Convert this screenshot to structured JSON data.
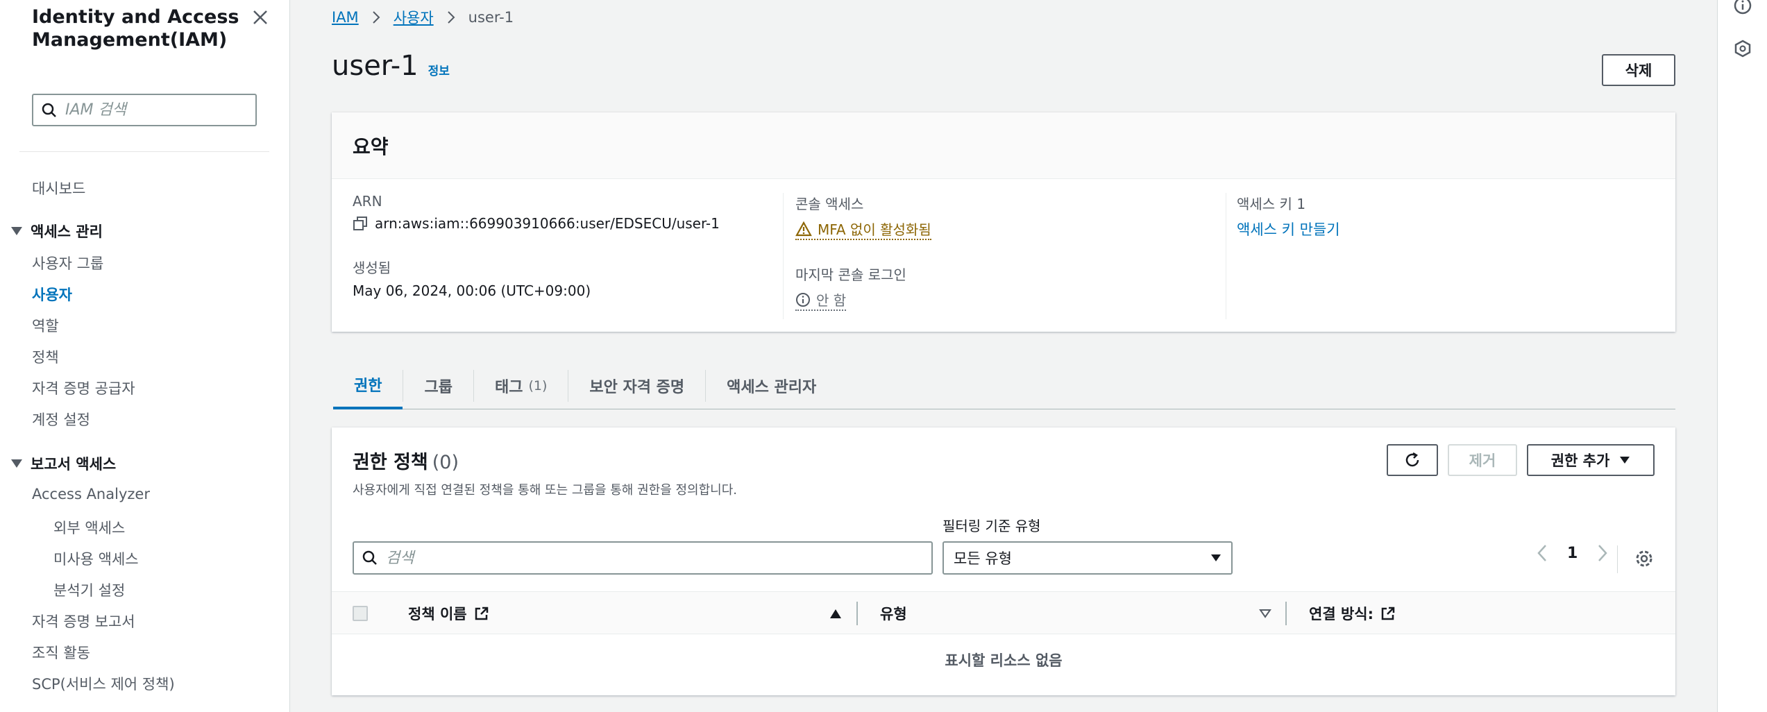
{
  "sidebar": {
    "title": "Identity and Access Management(IAM)",
    "search_placeholder": "IAM 검색",
    "dashboard": "대시보드",
    "section_access": "액세스 관리",
    "items_access": [
      "사용자 그룹",
      "사용자",
      "역할",
      "정책",
      "자격 증명 공급자",
      "계정 설정"
    ],
    "section_report": "보고서 액세스",
    "access_analyzer": "Access Analyzer",
    "analyzer_sub": [
      "외부 액세스",
      "미사용 액세스",
      "분석기 설정"
    ],
    "items_report": [
      "자격 증명 보고서",
      "조직 활동",
      "SCP(서비스 제어 정책)"
    ]
  },
  "breadcrumb": {
    "root": "IAM",
    "parent": "사용자",
    "current": "user-1"
  },
  "page": {
    "title": "user-1",
    "info": "정보",
    "delete_label": "삭제"
  },
  "summary": {
    "title": "요약",
    "arn_label": "ARN",
    "arn_value": "arn:aws:iam::669903910666:user/EDSECU/user-1",
    "created_label": "생성됨",
    "created_value": "May 06, 2024, 00:06 (UTC+09:00)",
    "console_label": "콘솔 액세스",
    "console_value": "MFA 없이 활성화됨",
    "last_login_label": "마지막 콘솔 로그인",
    "last_login_value": "안 함",
    "access_key_label": "액세스 키 1",
    "access_key_link": "액세스 키 만들기"
  },
  "tabs": [
    {
      "label": "권한",
      "count": ""
    },
    {
      "label": "그룹",
      "count": ""
    },
    {
      "label": "태그",
      "count": "(1)"
    },
    {
      "label": "보안 자격 증명",
      "count": ""
    },
    {
      "label": "액세스 관리자",
      "count": ""
    }
  ],
  "permissions": {
    "title": "권한 정책",
    "count": "(0)",
    "description": "사용자에게 직접 연결된 정책을 통해 또는 그룹을 통해 권한을 정의합니다.",
    "remove_label": "제거",
    "add_label": "권한 추가",
    "filter_label": "필터링 기준 유형",
    "search_placeholder": "검색",
    "filter_value": "모든 유형",
    "page_number": "1",
    "col_name": "정책 이름",
    "col_type": "유형",
    "col_attached": "연결 방식:",
    "empty_text": "표시할 리소스 없음"
  },
  "colors": {
    "link": "#0073bb",
    "warning": "#8d6605",
    "border": "#d5dbdb"
  }
}
